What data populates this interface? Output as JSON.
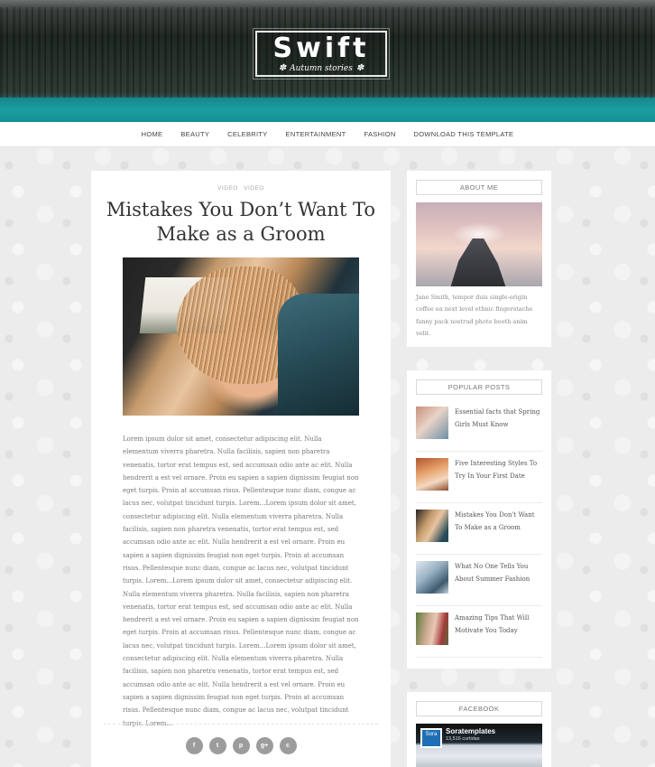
{
  "header": {
    "logo_title": "Swift",
    "logo_subtitle": "Autumn stories"
  },
  "nav": {
    "items": [
      "HOME",
      "BEAUTY",
      "CELEBRITY",
      "ENTERTAINMENT",
      "FASHION",
      "DOWNLOAD THIS TEMPLATE"
    ]
  },
  "post": {
    "labels": [
      "VIDEO",
      "VIDEO"
    ],
    "title": "Mistakes You Don’t Want To Make as a Groom",
    "body": "Lorem ipsum dolor sit amet, consectetur adipiscing elit. Nulla elementum viverra pharetra. Nulla facilisis, sapien non pharetra venenatis, tortor erat tempus est, sed accumsan odio ante ac elit. Nulla hendrerit a est vel ornare. Proin eu sapien a sapien dignissim feugiat non eget turpis. Proin at accumsan risus. Pellentesque nunc diam, congue ac lacus nec, volutpat tincidunt turpis. Lorem...Lorem ipsum dolor sit amet, consectetur adipiscing elit. Nulla elementum viverra pharetra. Nulla facilisis, sapien non pharetra venenatis, tortor erat tempus est, sed accumsan odio ante ac elit. Nulla hendrerit a est vel ornare. Proin eu sapien a sapien dignissim feugiat non eget turpis. Proin at accumsan risus. Pellentesque nunc diam, congue ac lacus nec, volutpat tincidunt turpis. Lorem...Lorem ipsum dolor sit amet, consectetur adipiscing elit. Nulla elementum viverra pharetra. Nulla facilisis, sapien non pharetra venenatis, tortor erat tempus est, sed accumsan odio ante ac elit. Nulla hendrerit a est vel ornare. Proin eu sapien a sapien dignissim feugiat non eget turpis. Proin at accumsan risus. Pellentesque nunc diam, congue ac lacus nec, volutpat tincidunt turpis. Lorem...Lorem ipsum dolor sit amet, consectetur adipiscing elit. Nulla elementum viverra pharetra. Nulla facilisis, sapien non pharetra venenatis, tortor erat tempus est, sed accumsan odio ante ac elit. Nulla hendrerit a est vel ornare. Proin eu sapien a sapien dignissim feugiat non eget turpis. Proin at accumsan risus. Pellentesque nunc diam, congue ac lacus nec, volutpat tincidunt turpis. Lorem...",
    "share_icons": [
      "f",
      "t",
      "p",
      "g+",
      "c"
    ]
  },
  "sidebar": {
    "about": {
      "title": "ABOUT ME",
      "text": "Jane Smith, tempor duis single-origin coffee ea next level ethnic fingerstache fanny pack nostrud photo booth anim velit."
    },
    "popular": {
      "title": "POPULAR POSTS",
      "items": [
        {
          "title": "Essential facts that Spring Girls Must Know"
        },
        {
          "title": "Five Interesting Styles To Try In Your First Date"
        },
        {
          "title": "Mistakes You Don't Want To Make as a Groom"
        },
        {
          "title": "What No One Tells You About Summer Fashion"
        },
        {
          "title": "Amazing Tips That Will Motivate You Today"
        }
      ]
    },
    "facebook": {
      "title": "FACEBOOK",
      "page_name": "Soratemplates",
      "likes": "13,516 curtidas",
      "logo_text": "Sora"
    }
  },
  "colors": {
    "accent_water": "#1b9a9b",
    "share_button": "#9c9c9c",
    "background": "#ececec"
  }
}
